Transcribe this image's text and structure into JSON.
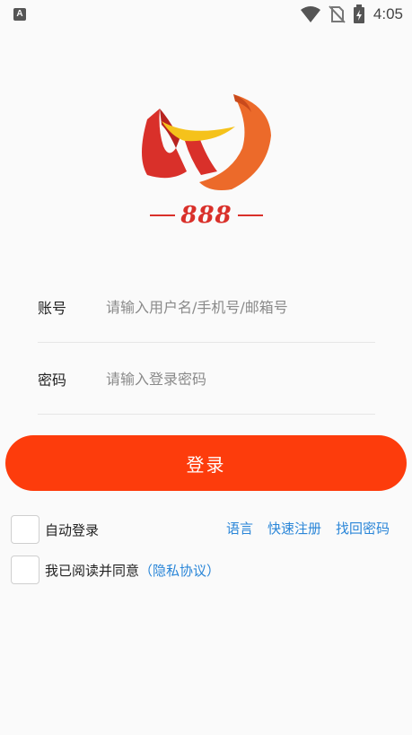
{
  "status_bar": {
    "left_icon": "A",
    "icons": [
      "wifi-icon",
      "no-sim-icon",
      "battery-charging-icon"
    ],
    "time": "4:05"
  },
  "logo": {
    "text": "888",
    "colors": {
      "red": "#d9302a",
      "orange": "#ec6a2a",
      "yellow": "#f5c21b"
    }
  },
  "form": {
    "account_label": "账号",
    "account_placeholder": "请输入用户名/手机号/邮箱号",
    "password_label": "密码",
    "password_placeholder": "请输入登录密码"
  },
  "login_button": "登录",
  "options": {
    "auto_login": "自动登录",
    "agree_text": "我已阅读并同意",
    "privacy_link": "（隐私协议）",
    "links": [
      "语言",
      "快速注册",
      "找回密码"
    ]
  },
  "colors": {
    "accent": "#fd3c0c",
    "link": "#2a86d8"
  }
}
